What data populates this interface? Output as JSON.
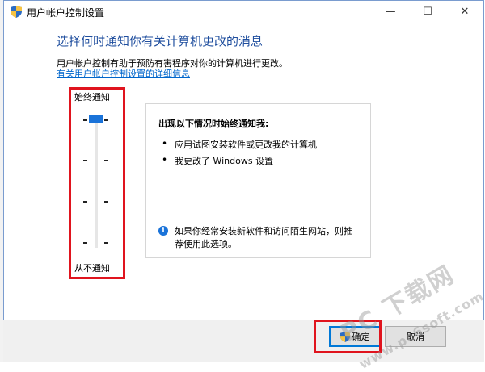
{
  "window": {
    "title": "用户帐户控制设置",
    "controls": {
      "minimize": "—",
      "maximize": "☐",
      "close": "✕"
    }
  },
  "header": {
    "heading": "选择何时通知你有关计算机更改的消息",
    "description": "用户帐户控制有助于预防有害程序对你的计算机进行更改。",
    "link": "有关用户帐户控制设置的详细信息"
  },
  "slider": {
    "top_label": "始终通知",
    "bottom_label": "从不通知",
    "level_count": 4,
    "selected_level": 4
  },
  "info_panel": {
    "title": "出现以下情况时始终通知我:",
    "bullets": [
      "应用试图安装软件或更改我的计算机",
      "我更改了 Windows 设置"
    ],
    "info_note": "如果你经常安装新软件和访问陌生网站，则推荐使用此选项。"
  },
  "buttons": {
    "ok": "确定",
    "cancel": "取消"
  },
  "watermark": {
    "big": "PC 下载网",
    "small": "www.pc6soft.com.cn"
  },
  "colors": {
    "heading": "#1f4e9e",
    "link": "#0066cc",
    "accent": "#1a73d9",
    "highlight": "#e0141e"
  },
  "icons": {
    "title": "uac-shield-icon",
    "info": "info-icon",
    "ok_button": "uac-shield-icon"
  }
}
